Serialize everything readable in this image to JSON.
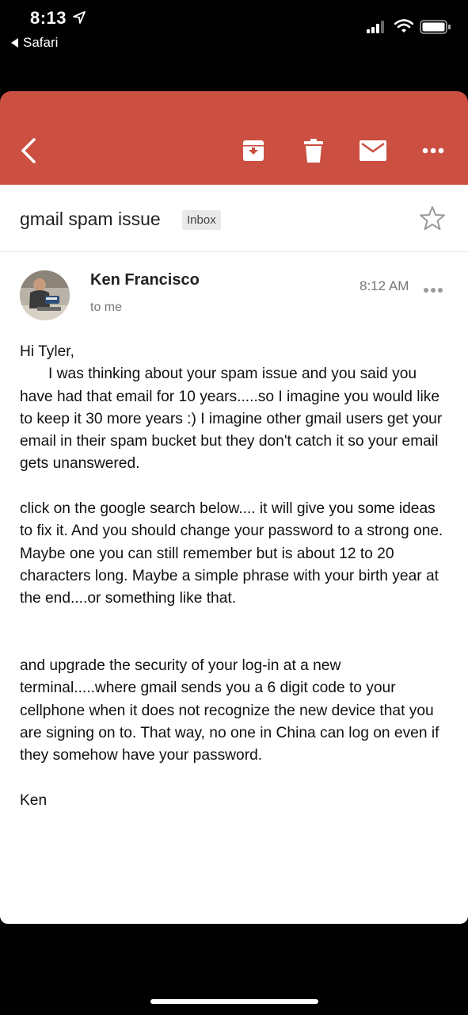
{
  "status_bar": {
    "time": "8:13",
    "back_app": "Safari"
  },
  "toolbar": {
    "back_icon": "chevron-left-icon",
    "archive_icon": "archive-icon",
    "delete_icon": "trash-icon",
    "mark_unread_icon": "mail-icon",
    "more_icon": "more-horizontal-icon",
    "background_color": "#cb5042"
  },
  "email": {
    "subject": "gmail spam issue",
    "label": "Inbox",
    "sender_name": "Ken Francisco",
    "recipient": "to me",
    "time": "8:12 AM",
    "body": {
      "greeting": "Hi Tyler,",
      "paragraph1": "I was thinking about your spam issue and you said you have had that email for 10 years.....so I imagine you would like to keep it 30 more years  :)  I imagine other gmail users get your email in their spam bucket but they don't catch it so your email gets unanswered.",
      "paragraph2": "click on the google search below.... it will give you some ideas to fix it.  And you should change your password to a strong one.  Maybe one you can still remember but is about 12 to 20 characters long.  Maybe a simple phrase with your birth year at the end....or something like that.",
      "paragraph3": "and upgrade the security of your log-in at a new terminal.....where gmail sends you a 6 digit code to your cellphone when it does not recognize the new device that you are signing on to.  That way, no one in China can log on even if they somehow have your password.",
      "signoff": "Ken"
    }
  }
}
